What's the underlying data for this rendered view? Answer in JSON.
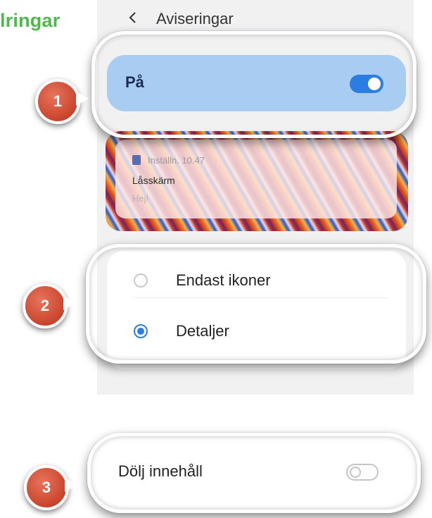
{
  "heading_fragment": "lringar",
  "topbar": {
    "title": "Aviseringar",
    "back_icon": "chevron-left-icon"
  },
  "master_toggle": {
    "label": "På",
    "state": "on"
  },
  "lockscreen_preview": {
    "app_name": "Inställn.",
    "time": "10.47",
    "title": "Låsskärm",
    "message": "Hej!"
  },
  "display_options": [
    {
      "label": "Endast ikoner",
      "selected": false
    },
    {
      "label": "Detaljer",
      "selected": true
    }
  ],
  "hide_content": {
    "label": "Dölj innehåll",
    "state": "off"
  },
  "callouts": [
    "1",
    "2",
    "3"
  ],
  "colors": {
    "accent": "#2a7de1",
    "badge": "#c9452c",
    "heading": "#4fb84a"
  }
}
